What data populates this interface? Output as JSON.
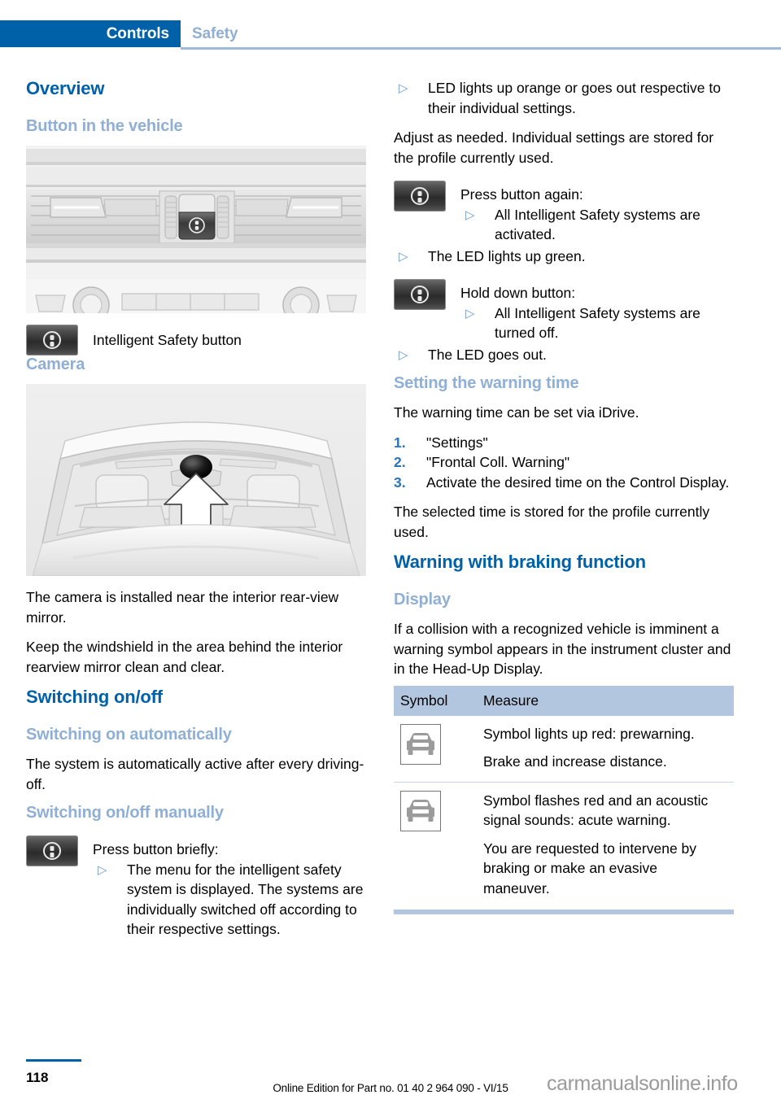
{
  "header": {
    "chapter": "Controls",
    "section": "Safety"
  },
  "left_column": {
    "overview_heading": "Overview",
    "button_in_vehicle_heading": "Button in the vehicle",
    "dashboard_figure_alt": "dashboard-with-intelligent-safety-button",
    "button_caption": "Intelligent Safety button",
    "camera_heading": "Camera",
    "camera_figure_alt": "windshield-interior-with-camera-arrow",
    "camera_para_1": "The camera is installed near the interior rear-view mirror.",
    "camera_para_2": "Keep the windshield in the area behind the interior rearview mirror clean and clear.",
    "switching_heading": "Switching on/off",
    "switching_auto_heading": "Switching on automatically",
    "switching_auto_para": "The system is automatically active after every driving-off.",
    "switching_manual_heading": "Switching on/off manually",
    "press_briefly_title": "Press button briefly:",
    "press_briefly_bullets": [
      "The menu for the intelligent safety system is displayed. The systems are individually switched off according to their respective settings."
    ]
  },
  "right_column": {
    "led_bullet": "LED lights up orange or goes out respective to their individual settings.",
    "adjust_para": "Adjust as needed. Individual settings are stored for the profile currently used.",
    "press_again_title": "Press button again:",
    "press_again_bullets": [
      "All Intelligent Safety systems are activated."
    ],
    "led_green_bullet": "The LED lights up green.",
    "hold_down_title": "Hold down button:",
    "hold_down_bullets": [
      "All Intelligent Safety systems are turned off."
    ],
    "led_out_bullet": "The LED goes out.",
    "warning_time_heading": "Setting the warning time",
    "warning_time_para": "The warning time can be set via iDrive.",
    "warning_time_steps": [
      {
        "num": "1.",
        "text": "\"Settings\""
      },
      {
        "num": "2.",
        "text": "\"Frontal Coll. Warning\""
      },
      {
        "num": "3.",
        "text": "Activate the desired time on the Control Display."
      }
    ],
    "warning_time_after": "The selected time is stored for the profile currently used.",
    "braking_heading": "Warning with braking function",
    "display_heading": "Display",
    "display_para": "If a collision with a recognized vehicle is imminent a warning symbol appears in the instrument cluster and in the Head-Up Display.",
    "table": {
      "columns": [
        "Symbol",
        "Measure"
      ],
      "rows": [
        {
          "symbol": "car-front-icon",
          "lines": [
            "Symbol lights up red: prewarning.",
            "Brake and increase distance."
          ]
        },
        {
          "symbol": "car-front-icon",
          "lines": [
            "Symbol flashes red and an acoustic signal sounds: acute warning.",
            "You are requested to intervene by braking or make an evasive maneuver."
          ]
        }
      ]
    }
  },
  "footer": {
    "page_number": "118",
    "edition_note": "Online Edition for Part no. 01 40 2 964 090 - VI/15",
    "watermark": "carmanualsonline.info"
  },
  "colors": {
    "brand_blue": "#0061A8",
    "light_blue": "#8FAFD4",
    "table_header_blue": "#B3C6E0",
    "bullet_blue": "#6B9BD2",
    "number_blue": "#2C72B8"
  }
}
